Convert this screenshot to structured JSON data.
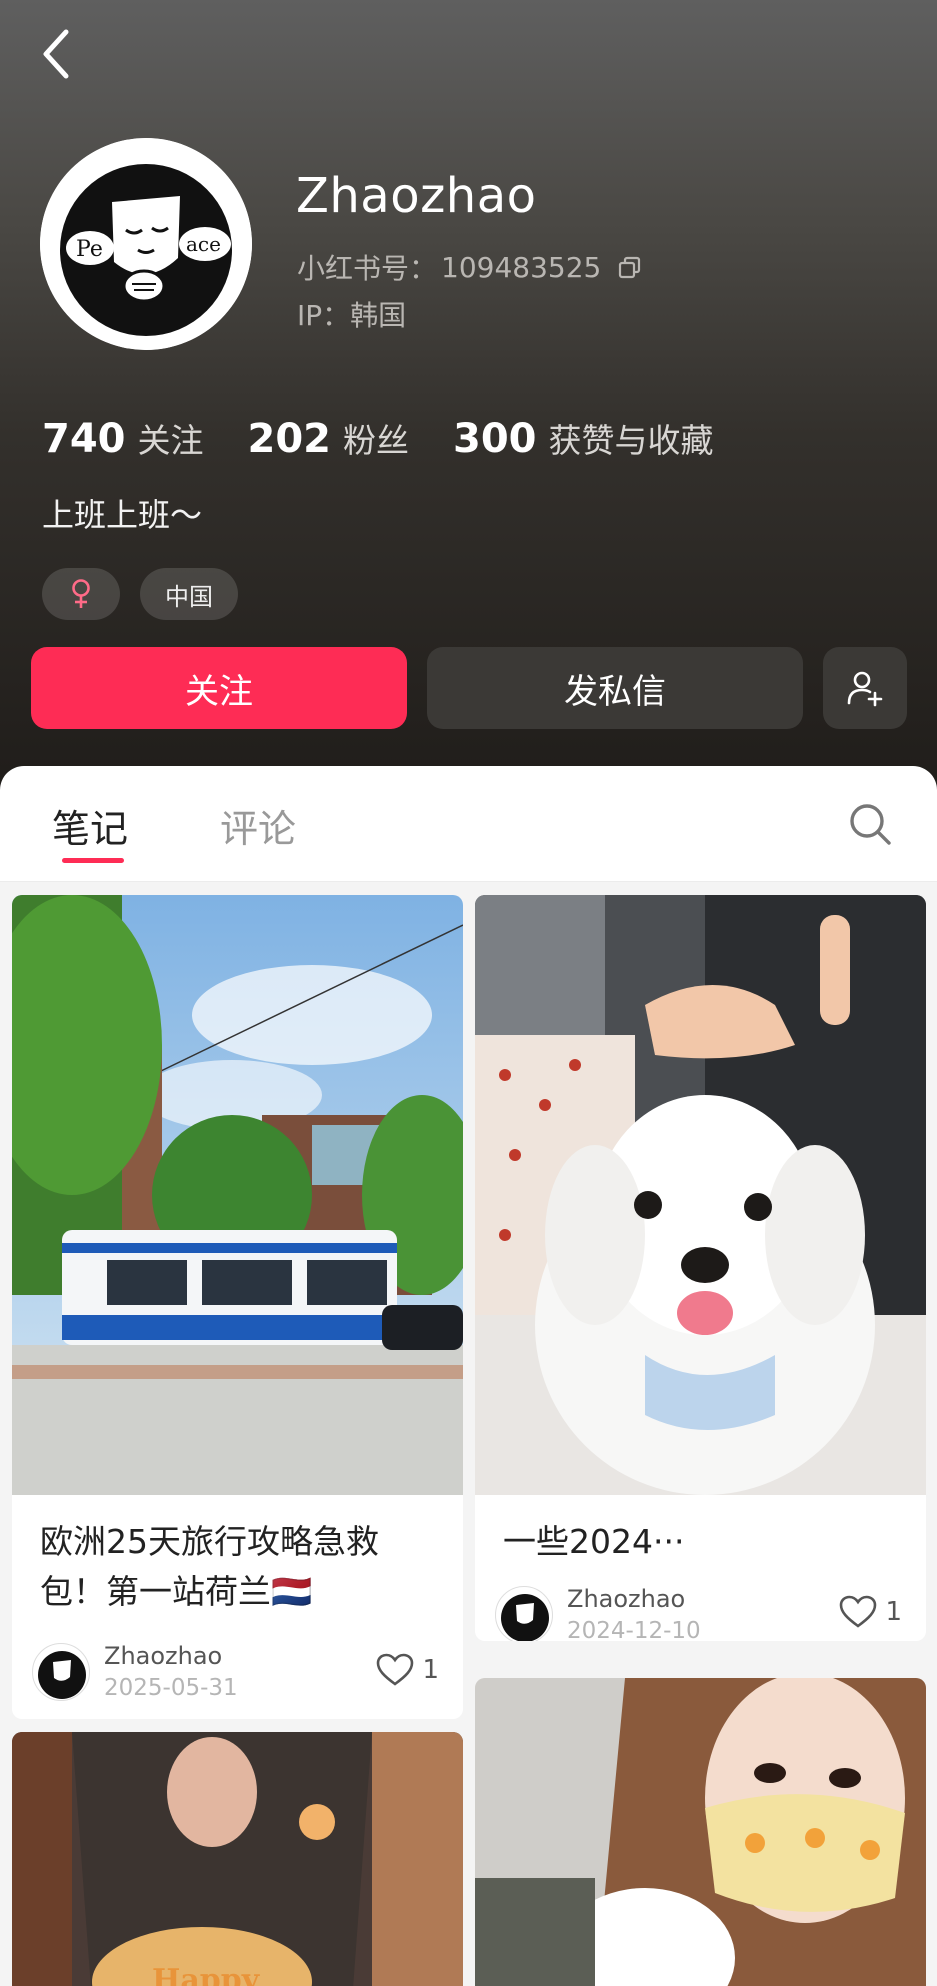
{
  "profile": {
    "nickname": "Zhaozhao",
    "id_label": "小红书号：",
    "id_value": "109483525",
    "ip_label": "IP：韩国",
    "bio": "上班上班～",
    "avatar_text_left": "Pe",
    "avatar_text_right": "ace"
  },
  "stats": [
    {
      "num": "740",
      "label": "关注"
    },
    {
      "num": "202",
      "label": "粉丝"
    },
    {
      "num": "300",
      "label": "获赞与收藏"
    }
  ],
  "tags": {
    "gender_icon": "female-icon",
    "region": "中国"
  },
  "actions": {
    "follow": "关注",
    "message": "发私信",
    "add_friend_icon": "add-user-icon"
  },
  "tabs": {
    "notes": "笔记",
    "comments": "评论",
    "active": "notes",
    "search_icon": "search-icon"
  },
  "colors": {
    "accent": "#fe2c55",
    "header_top": "#5f5f5f",
    "header_bottom": "#201d1a",
    "button_dark": "#3b3936"
  },
  "notes": [
    {
      "title_line1": "欧洲25天旅行攻略急救",
      "title_line2": "包！第一站荷兰🇳🇱",
      "author": "Zhaozhao",
      "date": "2025-05-31",
      "likes": "1"
    },
    {
      "title_line1": "一些2024···",
      "author": "Zhaozhao",
      "date": "2024-12-10",
      "likes": "1"
    },
    {
      "cake_text": "Happy"
    },
    {}
  ]
}
